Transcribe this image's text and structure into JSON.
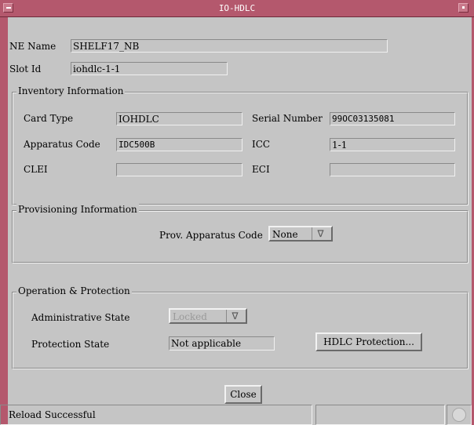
{
  "window": {
    "title": "IO-HDLC"
  },
  "ne_name": {
    "label": "NE Name",
    "value": "SHELF17_NB"
  },
  "slot_id": {
    "label": "Slot Id",
    "value": "iohdlc-1-1"
  },
  "inventory": {
    "legend": "Inventory Information",
    "card_type": {
      "label": "Card Type",
      "value": "IOHDLC"
    },
    "serial_number": {
      "label": "Serial Number",
      "value": "99OC03135081"
    },
    "apparatus_code": {
      "label": "Apparatus Code",
      "value": "IDC500B"
    },
    "icc": {
      "label": "ICC",
      "value": "1-1"
    },
    "clei": {
      "label": "CLEI",
      "value": ""
    },
    "eci": {
      "label": "ECI",
      "value": ""
    }
  },
  "provisioning": {
    "legend": "Provisioning Information",
    "prov_apparatus_code": {
      "label": "Prov. Apparatus Code",
      "selected": "None",
      "arrow": "∇"
    }
  },
  "operation": {
    "legend": "Operation & Protection",
    "admin_state": {
      "label": "Administrative State",
      "selected": "Locked",
      "arrow": "∇"
    },
    "protection_state": {
      "label": "Protection State",
      "value": "Not applicable"
    },
    "hdlc_protection_button": "HDLC Protection..."
  },
  "close_button": "Close",
  "status": {
    "message": "Reload Successful",
    "cell2": "",
    "cell3": ""
  },
  "icons": {
    "window_menu": "window-menu-icon",
    "minimize": "minimize-icon",
    "status_indicator": "status-light-icon"
  },
  "colors": {
    "titlebar": "#b4586d",
    "background": "#c5c5c5"
  }
}
